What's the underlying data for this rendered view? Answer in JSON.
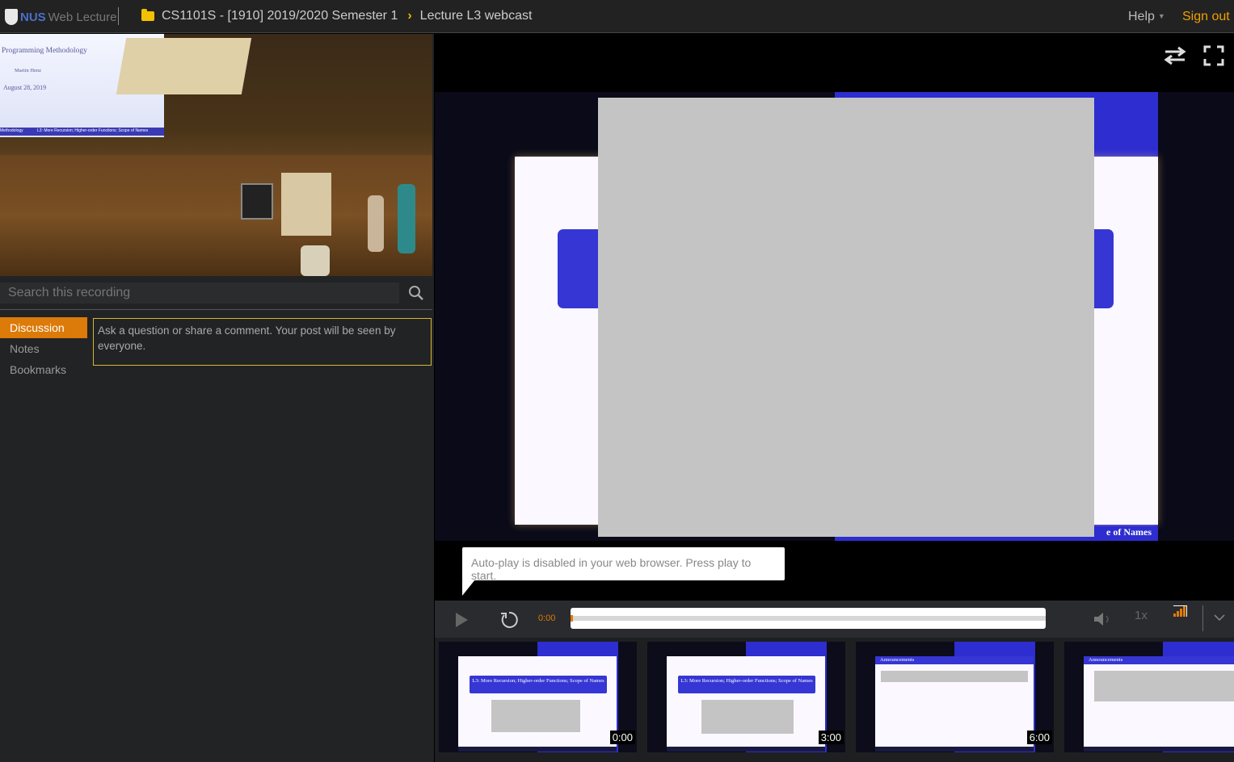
{
  "header": {
    "logo_nus": "NUS",
    "logo_text": "Web Lecture",
    "breadcrumb_course": "CS1101S - [1910] 2019/2020 Semester 1",
    "breadcrumb_lecture": "Lecture L3 webcast",
    "help_label": "Help",
    "signout_label": "Sign out"
  },
  "camera": {
    "screen_title": "Programming Methodology",
    "screen_author": "Martin Henz",
    "screen_date": "August 28, 2019",
    "screen_footer_left": "Methodology",
    "screen_footer_right": "L3: More Recursion; Higher-order Functions; Scope of Names"
  },
  "search": {
    "placeholder": "Search this recording"
  },
  "tabs": [
    {
      "label": "Discussion",
      "active": true
    },
    {
      "label": "Notes",
      "active": false
    },
    {
      "label": "Bookmarks",
      "active": false
    }
  ],
  "comment": {
    "placeholder": "Ask a question or share a comment. Your post will be seen by everyone."
  },
  "video": {
    "slide_footer": "e of Names",
    "autoplay_message": "Auto-play is disabled in your web browser. Press play to start."
  },
  "controls": {
    "current_time": "0:00",
    "progress_fraction": 0,
    "playback_rate": "1x"
  },
  "thumbnails": [
    {
      "time": "0:00",
      "kind": "title",
      "title": "L3: More Recursion; Higher-order Functions; Scope of Names"
    },
    {
      "time": "3:00",
      "kind": "title",
      "title": "L3: More Recursion; Higher-order Functions; Scope of Names"
    },
    {
      "time": "6:00",
      "kind": "announcements",
      "title": "Announcements"
    },
    {
      "time": "",
      "kind": "announcements",
      "title": "Announcements"
    }
  ],
  "colors": {
    "accent": "#dc7a0a",
    "signout": "#f0a000",
    "slide_blue": "#3636d4",
    "comment_border": "#d4b830"
  }
}
